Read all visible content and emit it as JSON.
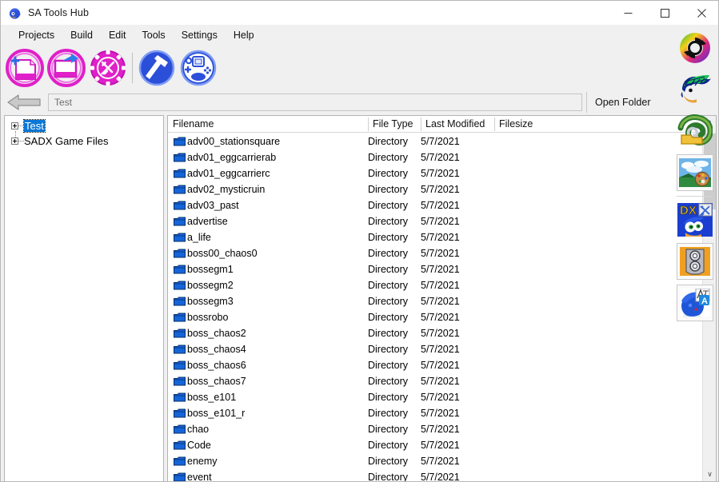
{
  "window": {
    "title": "SA Tools Hub",
    "app_icon": "sonic-app-icon",
    "controls": {
      "minimize": "—",
      "maximize": "□",
      "close": "✕"
    }
  },
  "menubar": {
    "items": [
      {
        "label": "Projects"
      },
      {
        "label": "Build"
      },
      {
        "label": "Edit"
      },
      {
        "label": "Tools"
      },
      {
        "label": "Settings"
      },
      {
        "label": "Help"
      }
    ]
  },
  "toolbar": {
    "buttons": [
      {
        "name": "new-project-icon",
        "tooltip": "New Project"
      },
      {
        "name": "open-project-icon",
        "tooltip": "Open Project"
      },
      {
        "name": "project-settings-icon",
        "tooltip": "Project Settings"
      },
      {
        "name": "build-hammer-icon",
        "tooltip": "Build"
      },
      {
        "name": "dreamcast-vmu-icon",
        "tooltip": "Dreamcast Tools"
      }
    ]
  },
  "navbar": {
    "back_label": "←",
    "path_value": "Test",
    "path_placeholder": "Test",
    "open_folder_label": "Open Folder"
  },
  "tree": {
    "nodes": [
      {
        "label": "Test",
        "selected": true
      },
      {
        "label": "SADX Game Files",
        "selected": false
      }
    ]
  },
  "filelist": {
    "columns": [
      {
        "label": "Filename"
      },
      {
        "label": "File Type"
      },
      {
        "label": "Last Modified"
      },
      {
        "label": "Filesize"
      }
    ],
    "rows": [
      {
        "filename": "adv00_stationsquare",
        "filetype": "Directory",
        "modified": "5/7/2021",
        "filesize": ""
      },
      {
        "filename": "adv01_eggcarrierab",
        "filetype": "Directory",
        "modified": "5/7/2021",
        "filesize": ""
      },
      {
        "filename": "adv01_eggcarrierc",
        "filetype": "Directory",
        "modified": "5/7/2021",
        "filesize": ""
      },
      {
        "filename": "adv02_mysticruin",
        "filetype": "Directory",
        "modified": "5/7/2021",
        "filesize": ""
      },
      {
        "filename": "adv03_past",
        "filetype": "Directory",
        "modified": "5/7/2021",
        "filesize": ""
      },
      {
        "filename": "advertise",
        "filetype": "Directory",
        "modified": "5/7/2021",
        "filesize": ""
      },
      {
        "filename": "a_life",
        "filetype": "Directory",
        "modified": "5/7/2021",
        "filesize": ""
      },
      {
        "filename": "boss00_chaos0",
        "filetype": "Directory",
        "modified": "5/7/2021",
        "filesize": ""
      },
      {
        "filename": "bossegm1",
        "filetype": "Directory",
        "modified": "5/7/2021",
        "filesize": ""
      },
      {
        "filename": "bossegm2",
        "filetype": "Directory",
        "modified": "5/7/2021",
        "filesize": ""
      },
      {
        "filename": "bossegm3",
        "filetype": "Directory",
        "modified": "5/7/2021",
        "filesize": ""
      },
      {
        "filename": "bossrobo",
        "filetype": "Directory",
        "modified": "5/7/2021",
        "filesize": ""
      },
      {
        "filename": "boss_chaos2",
        "filetype": "Directory",
        "modified": "5/7/2021",
        "filesize": ""
      },
      {
        "filename": "boss_chaos4",
        "filetype": "Directory",
        "modified": "5/7/2021",
        "filesize": ""
      },
      {
        "filename": "boss_chaos6",
        "filetype": "Directory",
        "modified": "5/7/2021",
        "filesize": ""
      },
      {
        "filename": "boss_chaos7",
        "filetype": "Directory",
        "modified": "5/7/2021",
        "filesize": ""
      },
      {
        "filename": "boss_e101",
        "filetype": "Directory",
        "modified": "5/7/2021",
        "filesize": ""
      },
      {
        "filename": "boss_e101_r",
        "filetype": "Directory",
        "modified": "5/7/2021",
        "filesize": ""
      },
      {
        "filename": "chao",
        "filetype": "Directory",
        "modified": "5/7/2021",
        "filesize": ""
      },
      {
        "filename": "Code",
        "filetype": "Directory",
        "modified": "5/7/2021",
        "filesize": ""
      },
      {
        "filename": "enemy",
        "filetype": "Directory",
        "modified": "5/7/2021",
        "filesize": ""
      },
      {
        "filename": "event",
        "filetype": "Directory",
        "modified": "5/7/2021",
        "filesize": ""
      }
    ],
    "scrollbar": {
      "up_arrow": "∧",
      "down_arrow": "∨"
    }
  },
  "sidebar": {
    "icons": [
      {
        "name": "texture-converter-icon",
        "tooltip": "Texture Converter"
      },
      {
        "name": "sonic-model-editor-icon",
        "tooltip": "Model Editor"
      },
      {
        "name": "level-workshop-icon",
        "tooltip": "Level Workshop"
      },
      {
        "name": "texture-editor-icon",
        "tooltip": "Texture Editor"
      },
      {
        "name": "sadx-dx-tools-icon",
        "tooltip": "SADX Tools"
      },
      {
        "name": "sound-tool-icon",
        "tooltip": "Sound Tool"
      },
      {
        "name": "text-editor-icon",
        "tooltip": "Text Editor"
      }
    ]
  },
  "colors": {
    "background": "#f0f0f0",
    "accent_magenta": "#e020c8",
    "accent_blue": "#2b4fd8",
    "folder_blue": "#1565d8",
    "selection_blue": "#0a78d7",
    "panel_white": "#ffffff"
  }
}
